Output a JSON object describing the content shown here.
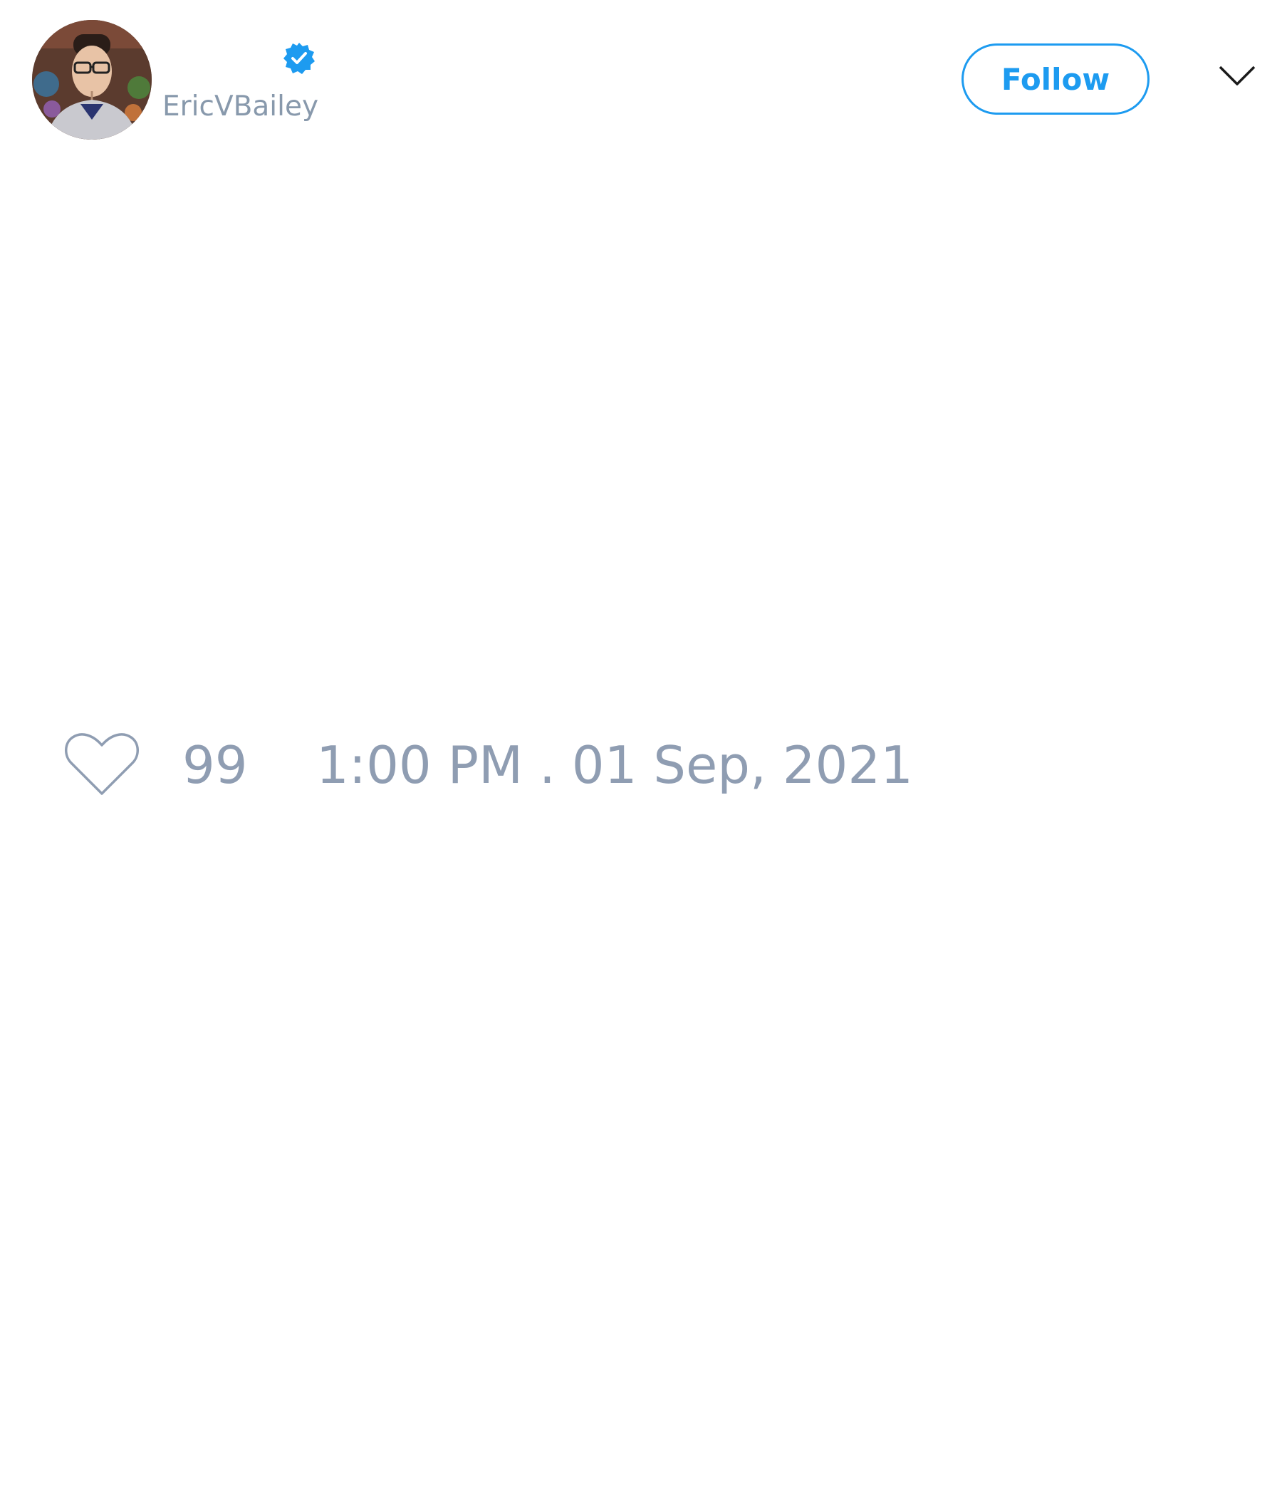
{
  "tweet": {
    "author": {
      "handle": "EricVBailey",
      "verified": true,
      "avatar_icon": "profile-photo"
    },
    "follow_label": "Follow",
    "menu_icon": "chevron-down-icon",
    "like": {
      "icon": "heart-icon",
      "count": "99"
    },
    "timestamp": "1:00 PM . 01 Sep, 2021"
  },
  "colors": {
    "accent": "#1d9bf0",
    "muted_text": "#8f9db2",
    "background": "#ffffff"
  }
}
